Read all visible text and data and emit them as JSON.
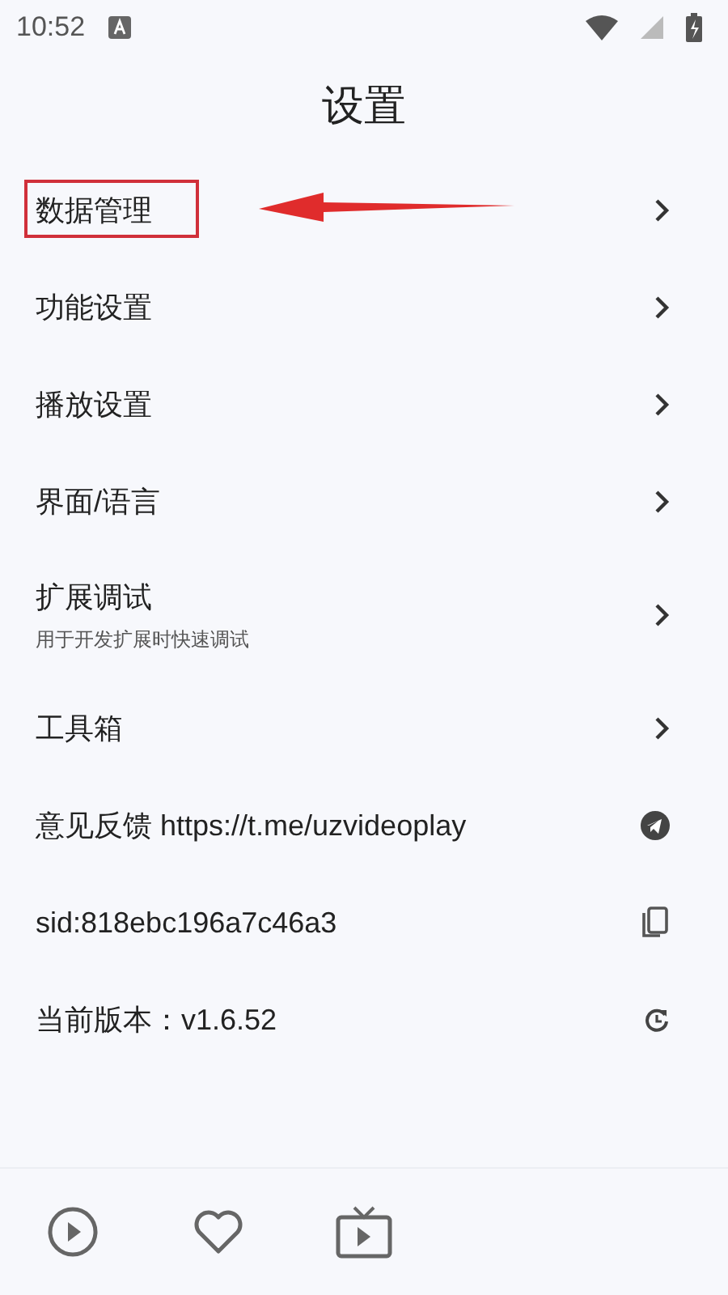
{
  "status_bar": {
    "time": "10:52"
  },
  "title": "设置",
  "items": [
    {
      "kind": "nav",
      "label": "数据管理",
      "highlighted": true
    },
    {
      "kind": "nav",
      "label": "功能设置",
      "highlighted": false
    },
    {
      "kind": "nav",
      "label": "播放设置",
      "highlighted": false
    },
    {
      "kind": "nav",
      "label": "界面/语言",
      "highlighted": false
    },
    {
      "kind": "nav",
      "label": "扩展调试",
      "subtitle": "用于开发扩展时快速调试",
      "highlighted": false
    },
    {
      "kind": "nav",
      "label": "工具箱",
      "highlighted": false
    },
    {
      "kind": "telegram",
      "label": "意见反馈 https://t.me/uzvideoplay",
      "highlighted": false
    },
    {
      "kind": "copy",
      "label": "sid:818ebc196a7c46a3",
      "highlighted": false
    },
    {
      "kind": "refresh",
      "label": "当前版本：v1.6.52",
      "highlighted": false
    }
  ],
  "bottom_nav": [
    {
      "kind": "play",
      "selected": false
    },
    {
      "kind": "heart",
      "selected": false
    },
    {
      "kind": "tv",
      "selected": false
    }
  ]
}
